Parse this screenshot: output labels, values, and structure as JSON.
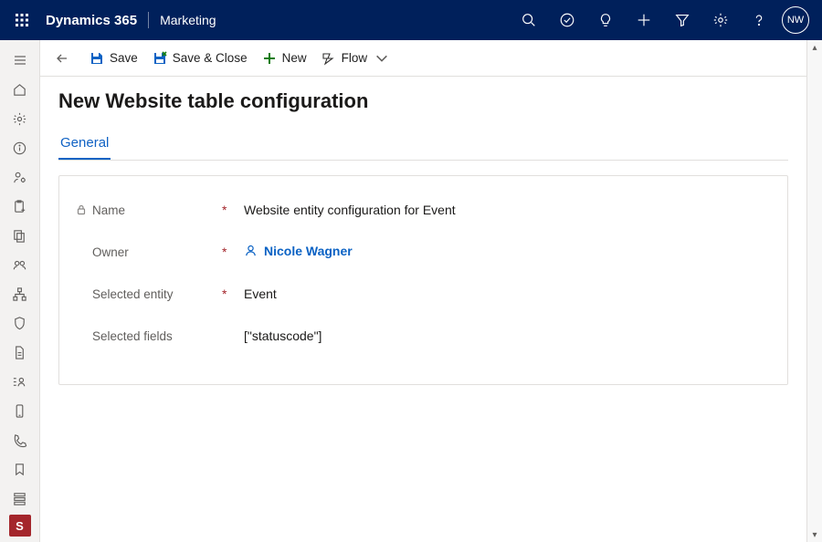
{
  "header": {
    "product": "Dynamics 365",
    "area": "Marketing",
    "avatar_initials": "NW"
  },
  "commandbar": {
    "save": "Save",
    "save_close": "Save & Close",
    "new": "New",
    "flow": "Flow"
  },
  "page": {
    "title": "New Website table configuration",
    "tab_general": "General"
  },
  "form": {
    "name_label": "Name",
    "name_value": "Website entity configuration for Event",
    "owner_label": "Owner",
    "owner_value": "Nicole Wagner",
    "entity_label": "Selected entity",
    "entity_value": "Event",
    "fields_label": "Selected fields",
    "fields_value": "[\"statuscode\"]"
  },
  "app_tile": "S"
}
